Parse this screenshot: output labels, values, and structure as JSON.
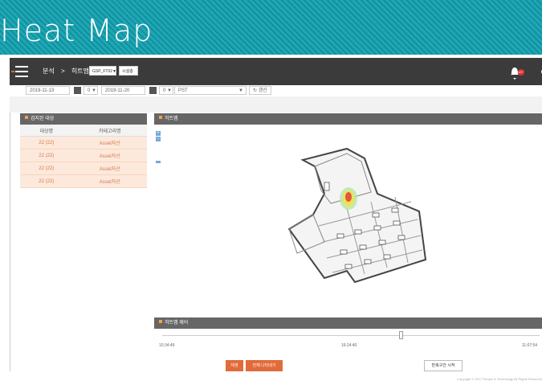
{
  "banner": {
    "title": "Heat Map"
  },
  "topbar": {
    "breadcrumb": [
      "분석",
      "히트맵"
    ],
    "selects": [
      "GSP_FT02▼",
      "시설층▼"
    ],
    "badge": "127"
  },
  "toolbar": {
    "start_date": "2019-11-13",
    "start_hour": "0",
    "end_date": "2019-11-20",
    "end_hour": "0",
    "timezone": "PST",
    "refresh": "갱신"
  },
  "left_panel": {
    "title": "검지된 대상",
    "columns": [
      "대상명",
      "카테고리명"
    ],
    "rows": [
      [
        "22 (22)",
        "Asset자산"
      ],
      [
        "22 (22)",
        "Asset자산"
      ],
      [
        "22 (22)",
        "Asset자산"
      ],
      [
        "22 (22)",
        "Asset자산"
      ]
    ]
  },
  "map_panel": {
    "title": "히트맵",
    "zoom_in": "+",
    "zoom_out": "−"
  },
  "control_panel": {
    "title": "히트맵 제어",
    "ticks": [
      "10:34:49",
      "16:24:40",
      "11:07:54"
    ],
    "btn_reset": "재생",
    "btn_play_all": "전체 나타내기",
    "btn_section": "반복구간 시작"
  },
  "footer": {
    "copyright": "Copyright © 2017 People & Technology All Rights Reserved"
  },
  "colors": {
    "accent": "#e26b3a",
    "banner": "#1fa7b5",
    "topbar": "#3b3b3b"
  }
}
